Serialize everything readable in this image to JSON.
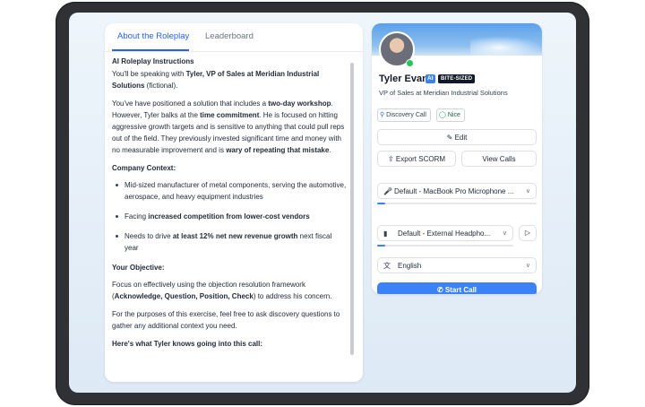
{
  "tabs": [
    {
      "label": "About the Roleplay"
    },
    {
      "label": "Leaderboard"
    }
  ],
  "instructions": {
    "heading": "AI Roleplay Instructions",
    "intro_pre": "You'll be speaking with ",
    "intro_bold": "Tyler, VP of Sales at Meridian Industrial Solutions",
    "intro_post": " (fictional).",
    "p2_a": "You've have positioned a solution that includes a ",
    "p2_b": "two-day workshop",
    "p2_c": ". However, Tyler balks at the ",
    "p2_d": "time commitment",
    "p2_e": ". He is focused on hitting aggressive growth targets and is sensitive to anything that could pull reps out of the field. They previously invested significant time and money with no measurable improvement and is ",
    "p2_f": "wary of repeating that mistake",
    "p2_g": ".",
    "company_heading": "Company Context:",
    "bullet1": "Mid-sized manufacturer of metal components, serving the automotive, aerospace, and heavy equipment industries",
    "bullet2_a": "Facing ",
    "bullet2_b": "increased competition from lower-cost vendors",
    "bullet3_a": "Needs to drive ",
    "bullet3_b": "at least 12% net new revenue growth",
    "bullet3_c": " next fiscal year",
    "objective_heading": "Your Objective:",
    "objective_a": "Focus on effectively using the objection resolution framework (",
    "objective_b": "Acknowledge, Question, Position, Check",
    "objective_c": ") to address his concern.",
    "purposes": "For the purposes of this exercise, feel free to ask discovery questions to gather any additional context you need.",
    "knows_heading": "Here's what Tyler knows going into this call:"
  },
  "persona": {
    "name": "Tyler Evans",
    "ai_badge": "AI",
    "size_badge": "BITE-SIZED",
    "role": "VP of Sales at Meridian Industrial Solutions",
    "tags": [
      "Discovery Call",
      "Nice"
    ]
  },
  "actions": {
    "edit": "Edit",
    "export": "Export SCORM",
    "view_calls": "View Calls"
  },
  "devices": {
    "microphone": "Default - MacBook Pro Microphone ...",
    "microphone_level": 0.05,
    "speaker": "Default - External Headpho...",
    "speaker_level": 0.06,
    "language": "English"
  },
  "start_call": "Start Call",
  "colors": {
    "accent": "#3b82f6",
    "tab_active": "#2563eb",
    "success": "#16a34a"
  }
}
